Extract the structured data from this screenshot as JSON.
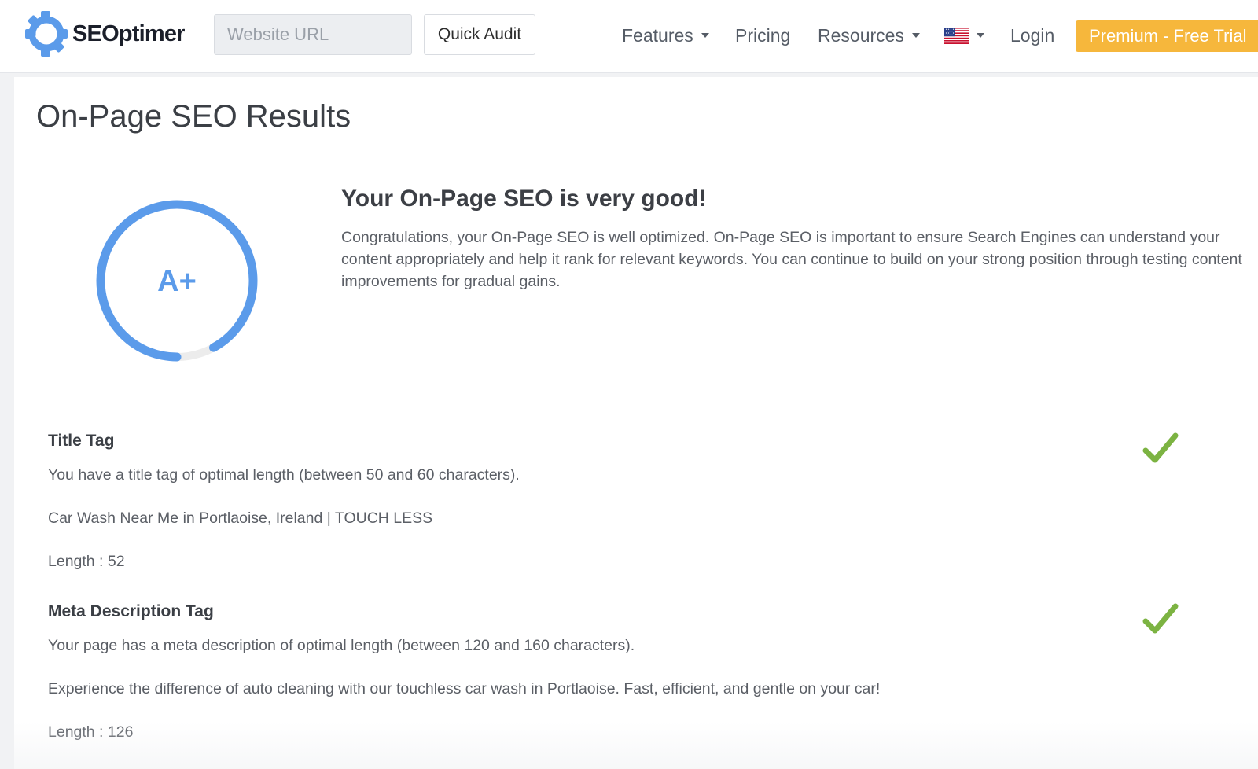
{
  "header": {
    "logo_text": "SEOptimer",
    "url_placeholder": "Website URL",
    "quick_audit_label": "Quick Audit",
    "nav": {
      "features": "Features",
      "pricing": "Pricing",
      "resources": "Resources",
      "login": "Login"
    },
    "premium_label": "Premium - Free Trial"
  },
  "colors": {
    "brand_blue": "#5b9bea",
    "premium_orange": "#f6b73c",
    "check_green": "#7cb342"
  },
  "page": {
    "title": "On-Page SEO Results",
    "grade": "A+",
    "grade_fill_fraction": 0.92,
    "summary_heading": "Your On-Page SEO is very good!",
    "summary_text": "Congratulations, your On-Page SEO is well optimized. On-Page SEO is important to ensure Search Engines can understand your content appropriately and help it rank for relevant keywords. You can continue to build on your strong position through testing content improvements for gradual gains."
  },
  "checks": {
    "title_tag": {
      "title": "Title Tag",
      "status": "pass",
      "description": "You have a title tag of optimal length (between 50 and 60 characters).",
      "value": "Car Wash Near Me in Portlaoise, Ireland | TOUCH LESS",
      "length": "Length : 52"
    },
    "meta_description": {
      "title": "Meta Description Tag",
      "status": "pass",
      "description": "Your page has a meta description of optimal length (between 120 and 160 characters).",
      "value": "Experience the difference of auto cleaning with our touchless car wash in Portlaoise. Fast, efficient, and gentle on your car!",
      "length": "Length : 126"
    }
  }
}
